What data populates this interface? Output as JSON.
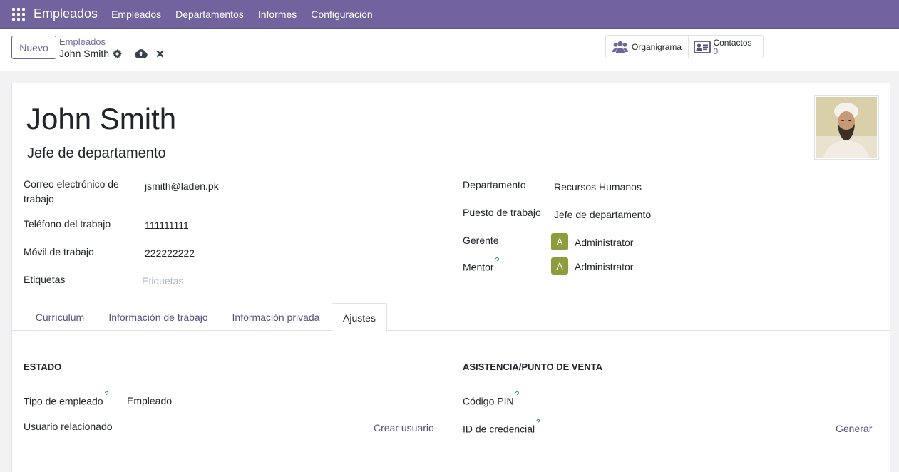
{
  "navbar": {
    "app_name": "Empleados",
    "menu": [
      "Empleados",
      "Departamentos",
      "Informes",
      "Configuración"
    ]
  },
  "control_panel": {
    "new_button": "Nuevo",
    "breadcrumb_parent": "Empleados",
    "breadcrumb_current": "John Smith",
    "smart_buttons": {
      "org_chart": "Organigrama",
      "contacts_label": "Contactos",
      "contacts_count": "0"
    }
  },
  "employee": {
    "name": "John Smith",
    "job_title": "Jefe de departamento",
    "left_fields": {
      "work_email_label": "Correo electrónico de trabajo",
      "work_email": "jsmith@laden.pk",
      "work_phone_label": "Teléfono del trabajo",
      "work_phone": "111111111",
      "mobile_label": "Móvil de trabajo",
      "mobile": "222222222",
      "tags_label": "Etiquetas",
      "tags_placeholder": "Etiquetas"
    },
    "right_fields": {
      "department_label": "Departamento",
      "department": "Recursos Humanos",
      "job_position_label": "Puesto de trabajo",
      "job_position": "Jefe de departamento",
      "manager_label": "Gerente",
      "manager_initial": "A",
      "manager": "Administrator",
      "coach_label": "Mentor",
      "coach_initial": "A",
      "coach": "Administrator"
    }
  },
  "tabs": [
    "Currículum",
    "Información de trabajo",
    "Información privada",
    "Ajustes"
  ],
  "active_tab": "Ajustes",
  "settings": {
    "status_title": "ESTADO",
    "employee_type_label": "Tipo de empleado",
    "employee_type": "Empleado",
    "related_user_label": "Usuario relacionado",
    "create_user": "Crear usuario",
    "attendance_title": "ASISTENCIA/PUNTO DE VENTA",
    "pin_label": "Código PIN",
    "badge_label": "ID de credencial",
    "generate": "Generar"
  },
  "help_mark": "?",
  "colors": {
    "brand": "#71639e",
    "avatar_badge": "#8f9c3b",
    "help": "#017e84"
  }
}
